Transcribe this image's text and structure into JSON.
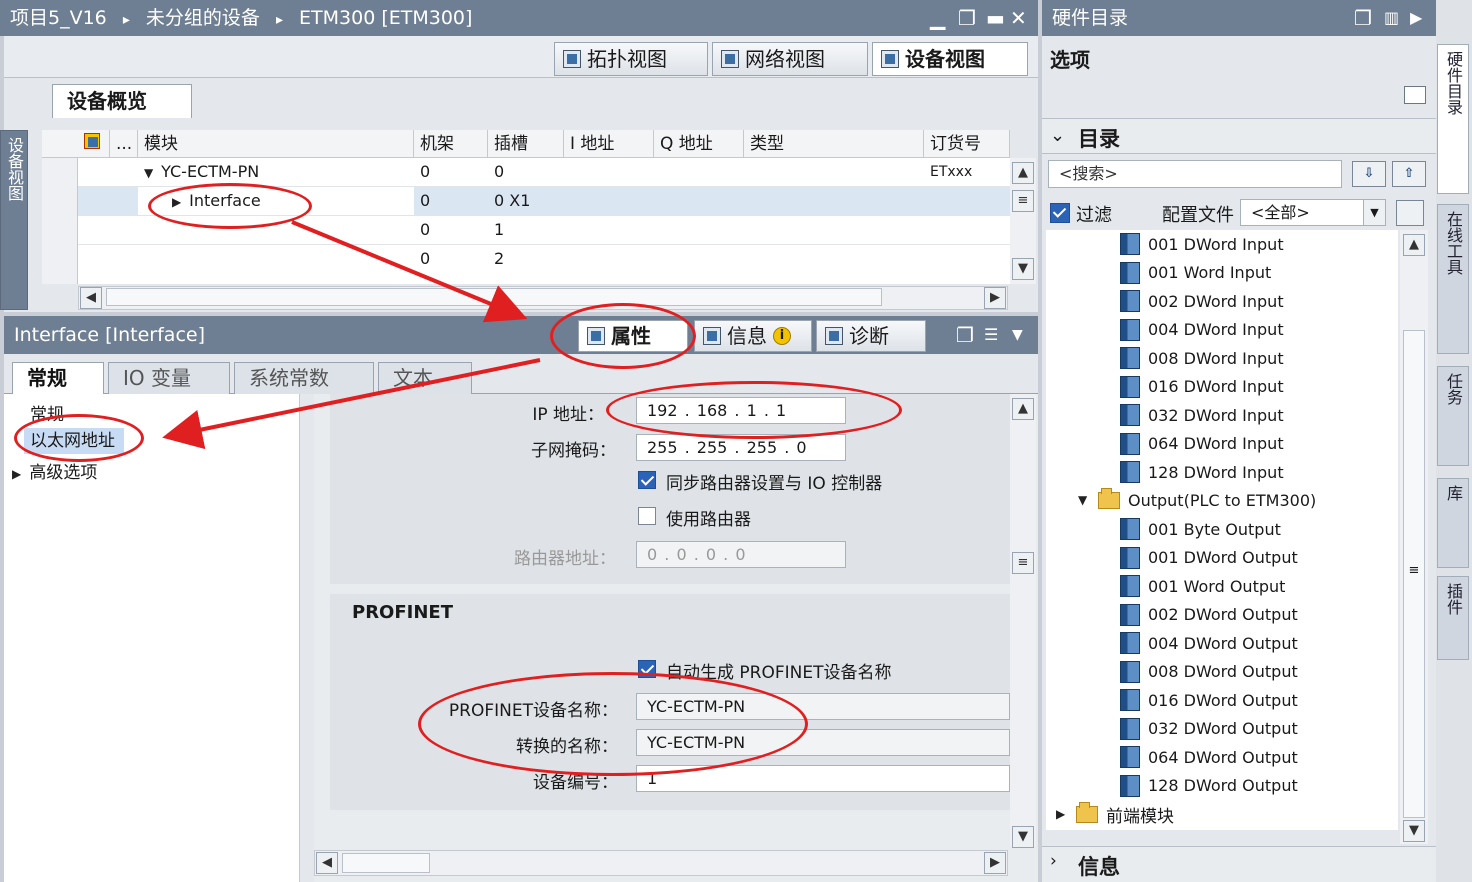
{
  "window": {
    "breadcrumb": [
      "项目5_V16",
      "未分组的设备",
      "ETM300 [ETM300]"
    ],
    "sep": "▸",
    "controls": [
      "▁",
      "❐",
      "▬",
      "✕"
    ]
  },
  "view_tabs": [
    "拓扑视图",
    "网络视图",
    "设备视图"
  ],
  "device_overview": {
    "tab": "设备概览",
    "side_label": "设备视图",
    "columns": [
      "...",
      "模块",
      "机架",
      "插槽",
      "I 地址",
      "Q 地址",
      "类型",
      "订货号"
    ],
    "rows": [
      {
        "module": "YC-ECTM-PN",
        "rack": "0",
        "slot": "0",
        "order": "ETxxx",
        "expanded": true
      },
      {
        "module": "Interface",
        "rack": "0",
        "slot": "0 X1",
        "order": "",
        "expanded": false
      },
      {
        "module": "",
        "rack": "0",
        "slot": "1",
        "order": ""
      },
      {
        "module": "",
        "rack": "0",
        "slot": "2",
        "order": ""
      }
    ]
  },
  "properties": {
    "title": "Interface [Interface]",
    "top_tabs": [
      "属性",
      "信息",
      "诊断"
    ],
    "info_badge": "i",
    "tabs": [
      "常规",
      "IO 变量",
      "系统常数",
      "文本"
    ],
    "nav": [
      "常规",
      "以太网地址",
      "高级选项"
    ],
    "ip_label": "IP 地址：",
    "ip_value": "192 . 168 . 1    . 1",
    "mask_label": "子网掩码：",
    "mask_value": "255 . 255 . 255 . 0",
    "sync_router": "同步路由器设置与 IO 控制器",
    "use_router": "使用路由器",
    "router_label": "路由器地址：",
    "router_value": "0    . 0    . 0    . 0",
    "profinet_header": "PROFINET",
    "auto_name": "自动生成 PROFINET设备名称",
    "device_name_label": "PROFINET设备名称：",
    "device_name_value": "YC-ECTM-PN",
    "converted_label": "转换的名称：",
    "converted_value": "YC-ECTM-PN",
    "device_no_label": "设备编号：",
    "device_no_value": "1"
  },
  "catalog": {
    "title": "硬件目录",
    "options": "选项",
    "section": "目录",
    "search_placeholder": "<搜索>",
    "filter": "过滤",
    "profile_label": "配置文件",
    "profile_value": "<全部>",
    "items": [
      "001 DWord Input",
      "001 Word Input",
      "002 DWord Input",
      "004 DWord Input",
      "008 DWord Input",
      "016 DWord Input",
      "032 DWord Input",
      "064 DWord Input",
      "128 DWord Input"
    ],
    "output_folder": "Output(PLC to ETM300)",
    "output_items": [
      "001 Byte Output",
      "001 DWord Output",
      "001 Word Output",
      "002 DWord Output",
      "004 DWord Output",
      "008 DWord Output",
      "016 DWord Output",
      "032 DWord Output",
      "064 DWord Output",
      "128 DWord Output"
    ],
    "front_folder": "前端模块",
    "info_section": "信息"
  },
  "side_tabs": [
    "硬件目录",
    "在线工具",
    "任务",
    "库",
    "插件"
  ],
  "colors": {
    "title_bar": "#6f7f93",
    "annotation": "#e02020",
    "selection": "#c7dcf4"
  }
}
